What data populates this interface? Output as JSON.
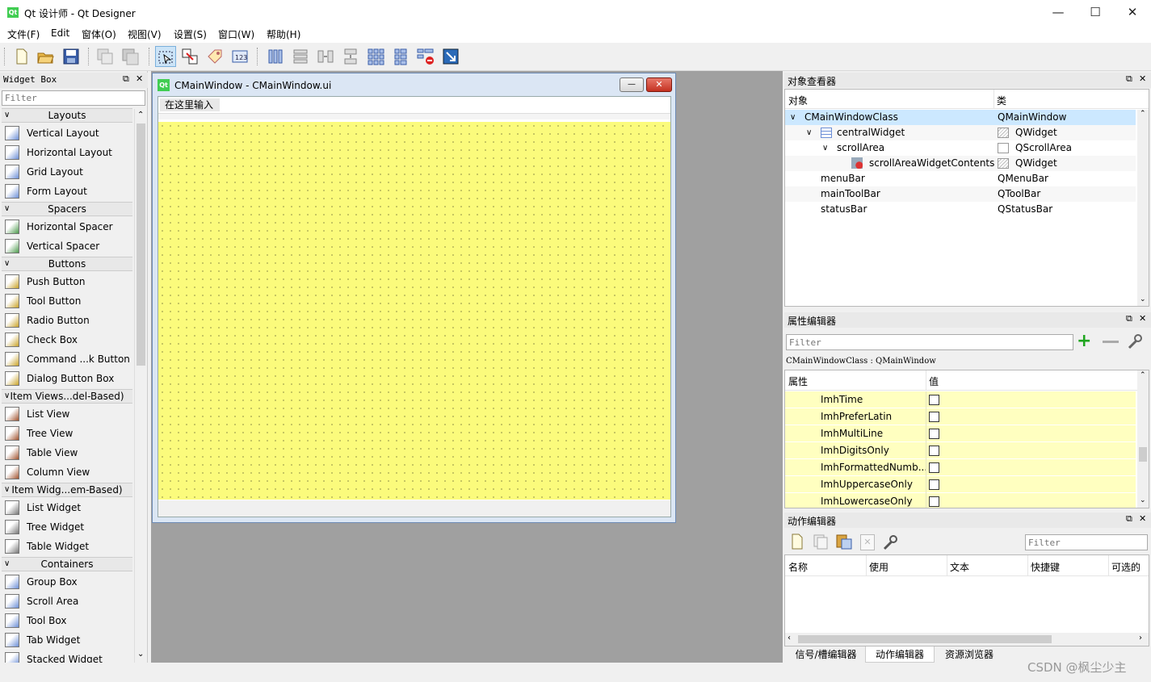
{
  "window": {
    "title": "Qt 设计师 - Qt Designer",
    "app_icon": "Qt",
    "min": "—",
    "max": "☐",
    "close": "✕"
  },
  "menu": [
    "文件(F)",
    "Edit",
    "窗体(O)",
    "视图(V)",
    "设置(S)",
    "窗口(W)",
    "帮助(H)"
  ],
  "widget_box": {
    "title": "Widget Box",
    "filter_placeholder": "Filter",
    "sections": [
      {
        "name": "Layouts",
        "items": [
          "Vertical Layout",
          "Horizontal Layout",
          "Grid Layout",
          "Form Layout"
        ]
      },
      {
        "name": "Spacers",
        "items": [
          "Horizontal Spacer",
          "Vertical Spacer"
        ]
      },
      {
        "name": "Buttons",
        "items": [
          "Push Button",
          "Tool Button",
          "Radio Button",
          "Check Box",
          "Command ...k Button",
          "Dialog Button Box"
        ]
      },
      {
        "name": "Item Views...del-Based)",
        "items": [
          "List View",
          "Tree View",
          "Table View",
          "Column View"
        ]
      },
      {
        "name": "Item Widg...em-Based)",
        "items": [
          "List Widget",
          "Tree Widget",
          "Table Widget"
        ]
      },
      {
        "name": "Containers",
        "items": [
          "Group Box",
          "Scroll Area",
          "Tool Box",
          "Tab Widget",
          "Stacked Widget"
        ]
      }
    ]
  },
  "form": {
    "title": "CMainWindow - CMainWindow.ui",
    "menu_placeholder": "在这里输入",
    "icon": "Qt"
  },
  "object_inspector": {
    "title": "对象查看器",
    "col_object": "对象",
    "col_class": "类",
    "rows": [
      {
        "name": "CMainWindowClass",
        "cls": "QMainWindow",
        "level": 0,
        "arrow": "v",
        "selected": true
      },
      {
        "name": "centralWidget",
        "cls": "QWidget",
        "level": 1,
        "arrow": "v"
      },
      {
        "name": "scrollArea",
        "cls": "QScrollArea",
        "level": 2,
        "arrow": "v"
      },
      {
        "name": "scrollAreaWidgetContents",
        "cls": "QWidget",
        "level": 3,
        "arrow": ""
      },
      {
        "name": "menuBar",
        "cls": "QMenuBar",
        "level": 1,
        "arrow": ""
      },
      {
        "name": "mainToolBar",
        "cls": "QToolBar",
        "level": 1,
        "arrow": ""
      },
      {
        "name": "statusBar",
        "cls": "QStatusBar",
        "level": 1,
        "arrow": ""
      }
    ]
  },
  "property_editor": {
    "title": "属性编辑器",
    "filter_placeholder": "Filter",
    "object_line": "CMainWindowClass : QMainWindow",
    "col_prop": "属性",
    "col_value": "值",
    "rows": [
      "ImhTime",
      "ImhPreferLatin",
      "ImhMultiLine",
      "ImhDigitsOnly",
      "ImhFormattedNumb...",
      "ImhUppercaseOnly",
      "ImhLowercaseOnly"
    ]
  },
  "action_editor": {
    "title": "动作编辑器",
    "filter_placeholder": "Filter",
    "cols": [
      "名称",
      "使用",
      "文本",
      "快捷键",
      "可选的"
    ]
  },
  "bottom_tabs": [
    "信号/槽编辑器",
    "动作编辑器",
    "资源浏览器"
  ],
  "watermark": "CSDN @枫尘少主",
  "colors": {
    "canvas": "#fbfb7c",
    "selection": "#cce8ff",
    "property_row": "#ffffc0"
  }
}
